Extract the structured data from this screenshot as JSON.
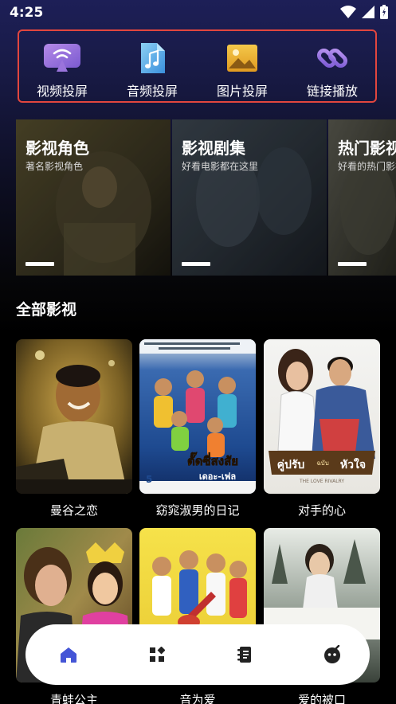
{
  "status_bar": {
    "time": "4:25"
  },
  "cast_menu": {
    "items": [
      {
        "label": "视频投屏",
        "icon": "tv-cast-icon"
      },
      {
        "label": "音频投屏",
        "icon": "music-file-icon"
      },
      {
        "label": "图片投屏",
        "icon": "image-icon"
      },
      {
        "label": "链接播放",
        "icon": "link-icon"
      }
    ]
  },
  "banner": {
    "cards": [
      {
        "title": "影视角色",
        "subtitle": "著名影视角色"
      },
      {
        "title": "影视剧集",
        "subtitle": "好看电影都在这里"
      },
      {
        "title": "热门影视",
        "subtitle": "好看的热门影视"
      }
    ]
  },
  "main": {
    "section_title": "全部影视",
    "movies": [
      {
        "title": "曼谷之恋"
      },
      {
        "title": "窈窕淑男的日记",
        "poster_text": [
          "ตั๊ดซี่สงสัย",
          "เดอะ-เฟล",
          "5"
        ]
      },
      {
        "title": "对手的心",
        "poster_text": [
          "คู่ปรับ",
          "ฉบับ",
          "หัวใจ",
          "THE LOVE RIVALRY"
        ]
      },
      {
        "title": "青蛙公主"
      },
      {
        "title": "音为爱"
      },
      {
        "title": "爱的被口"
      }
    ]
  },
  "bottom_nav": {
    "items": [
      {
        "icon": "home-icon",
        "active": true
      },
      {
        "icon": "apps-grid-icon",
        "active": false
      },
      {
        "icon": "notebook-icon",
        "active": false
      },
      {
        "icon": "bomb-icon",
        "active": false
      }
    ]
  },
  "colors": {
    "highlight_border": "#e2463e",
    "nav_active": "#4455d6",
    "nav_inactive": "#222222"
  }
}
